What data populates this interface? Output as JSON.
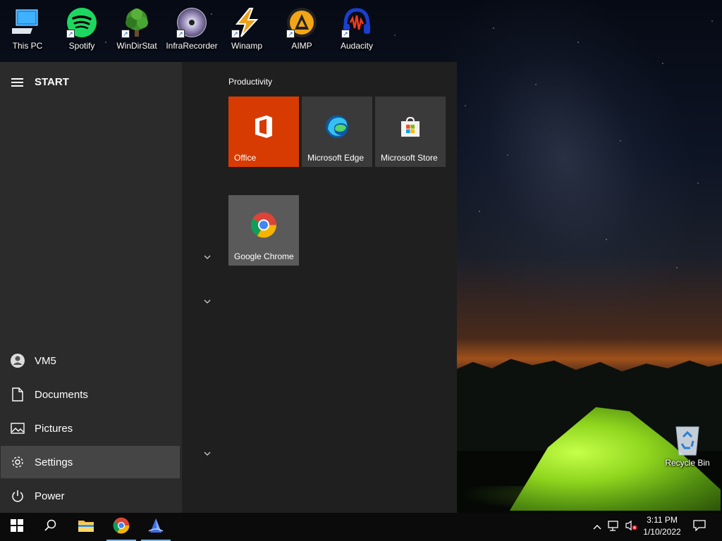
{
  "desktop": {
    "icons": [
      {
        "label": "This PC",
        "icon": "computer-icon",
        "shortcut": false
      },
      {
        "label": "Spotify",
        "icon": "spotify-icon",
        "shortcut": true
      },
      {
        "label": "WinDirStat",
        "icon": "windirstat-icon",
        "shortcut": true
      },
      {
        "label": "InfraRecorder",
        "icon": "infrarecorder-icon",
        "shortcut": true
      },
      {
        "label": "Winamp",
        "icon": "winamp-icon",
        "shortcut": true
      },
      {
        "label": "AIMP",
        "icon": "aimp-icon",
        "shortcut": true
      },
      {
        "label": "Audacity",
        "icon": "audacity-icon",
        "shortcut": true
      }
    ],
    "recycle_bin": {
      "label": "Recycle Bin",
      "icon": "recycle-bin-icon"
    }
  },
  "start_menu": {
    "header": "START",
    "user": "VM5",
    "nav": [
      {
        "label": "Documents",
        "icon": "document-icon"
      },
      {
        "label": "Pictures",
        "icon": "pictures-icon"
      },
      {
        "label": "Settings",
        "icon": "gear-icon",
        "active": true
      },
      {
        "label": "Power",
        "icon": "power-icon"
      }
    ],
    "group_title": "Productivity",
    "tiles": [
      {
        "label": "Office",
        "icon": "office-icon",
        "color": "#d83b01"
      },
      {
        "label": "Microsoft Edge",
        "icon": "edge-icon",
        "color": "#3a3a3a"
      },
      {
        "label": "Microsoft Store",
        "icon": "store-icon",
        "color": "#3a3a3a"
      },
      {
        "label": "Google Chrome",
        "icon": "chrome-icon",
        "color": "#5a5a5a"
      }
    ]
  },
  "taskbar": {
    "pinned": [
      {
        "name": "File Explorer",
        "icon": "folder-icon",
        "running": false
      },
      {
        "name": "Google Chrome",
        "icon": "chrome-icon",
        "running": true
      },
      {
        "name": "App",
        "icon": "app-icon",
        "running": true
      }
    ],
    "clock": {
      "time": "3:11 PM",
      "date": "1/10/2022"
    }
  },
  "colors": {
    "accent": "#76b9ed",
    "office_orange": "#d83b01",
    "tent_green": "#9be02a"
  }
}
